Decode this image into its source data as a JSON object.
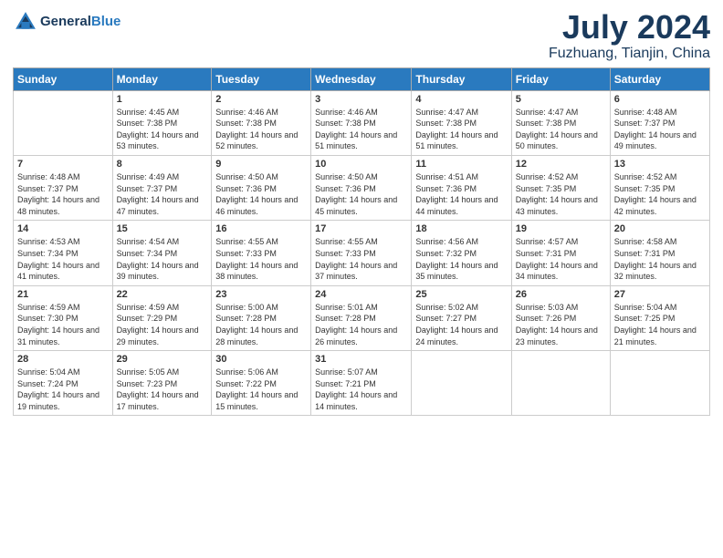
{
  "logo": {
    "text1": "General",
    "text2": "Blue"
  },
  "title": "July 2024",
  "location": "Fuzhuang, Tianjin, China",
  "weekdays": [
    "Sunday",
    "Monday",
    "Tuesday",
    "Wednesday",
    "Thursday",
    "Friday",
    "Saturday"
  ],
  "weeks": [
    [
      {
        "day": "",
        "sunrise": "",
        "sunset": "",
        "daylight": ""
      },
      {
        "day": "1",
        "sunrise": "Sunrise: 4:45 AM",
        "sunset": "Sunset: 7:38 PM",
        "daylight": "Daylight: 14 hours and 53 minutes."
      },
      {
        "day": "2",
        "sunrise": "Sunrise: 4:46 AM",
        "sunset": "Sunset: 7:38 PM",
        "daylight": "Daylight: 14 hours and 52 minutes."
      },
      {
        "day": "3",
        "sunrise": "Sunrise: 4:46 AM",
        "sunset": "Sunset: 7:38 PM",
        "daylight": "Daylight: 14 hours and 51 minutes."
      },
      {
        "day": "4",
        "sunrise": "Sunrise: 4:47 AM",
        "sunset": "Sunset: 7:38 PM",
        "daylight": "Daylight: 14 hours and 51 minutes."
      },
      {
        "day": "5",
        "sunrise": "Sunrise: 4:47 AM",
        "sunset": "Sunset: 7:38 PM",
        "daylight": "Daylight: 14 hours and 50 minutes."
      },
      {
        "day": "6",
        "sunrise": "Sunrise: 4:48 AM",
        "sunset": "Sunset: 7:37 PM",
        "daylight": "Daylight: 14 hours and 49 minutes."
      }
    ],
    [
      {
        "day": "7",
        "sunrise": "Sunrise: 4:48 AM",
        "sunset": "Sunset: 7:37 PM",
        "daylight": "Daylight: 14 hours and 48 minutes."
      },
      {
        "day": "8",
        "sunrise": "Sunrise: 4:49 AM",
        "sunset": "Sunset: 7:37 PM",
        "daylight": "Daylight: 14 hours and 47 minutes."
      },
      {
        "day": "9",
        "sunrise": "Sunrise: 4:50 AM",
        "sunset": "Sunset: 7:36 PM",
        "daylight": "Daylight: 14 hours and 46 minutes."
      },
      {
        "day": "10",
        "sunrise": "Sunrise: 4:50 AM",
        "sunset": "Sunset: 7:36 PM",
        "daylight": "Daylight: 14 hours and 45 minutes."
      },
      {
        "day": "11",
        "sunrise": "Sunrise: 4:51 AM",
        "sunset": "Sunset: 7:36 PM",
        "daylight": "Daylight: 14 hours and 44 minutes."
      },
      {
        "day": "12",
        "sunrise": "Sunrise: 4:52 AM",
        "sunset": "Sunset: 7:35 PM",
        "daylight": "Daylight: 14 hours and 43 minutes."
      },
      {
        "day": "13",
        "sunrise": "Sunrise: 4:52 AM",
        "sunset": "Sunset: 7:35 PM",
        "daylight": "Daylight: 14 hours and 42 minutes."
      }
    ],
    [
      {
        "day": "14",
        "sunrise": "Sunrise: 4:53 AM",
        "sunset": "Sunset: 7:34 PM",
        "daylight": "Daylight: 14 hours and 41 minutes."
      },
      {
        "day": "15",
        "sunrise": "Sunrise: 4:54 AM",
        "sunset": "Sunset: 7:34 PM",
        "daylight": "Daylight: 14 hours and 39 minutes."
      },
      {
        "day": "16",
        "sunrise": "Sunrise: 4:55 AM",
        "sunset": "Sunset: 7:33 PM",
        "daylight": "Daylight: 14 hours and 38 minutes."
      },
      {
        "day": "17",
        "sunrise": "Sunrise: 4:55 AM",
        "sunset": "Sunset: 7:33 PM",
        "daylight": "Daylight: 14 hours and 37 minutes."
      },
      {
        "day": "18",
        "sunrise": "Sunrise: 4:56 AM",
        "sunset": "Sunset: 7:32 PM",
        "daylight": "Daylight: 14 hours and 35 minutes."
      },
      {
        "day": "19",
        "sunrise": "Sunrise: 4:57 AM",
        "sunset": "Sunset: 7:31 PM",
        "daylight": "Daylight: 14 hours and 34 minutes."
      },
      {
        "day": "20",
        "sunrise": "Sunrise: 4:58 AM",
        "sunset": "Sunset: 7:31 PM",
        "daylight": "Daylight: 14 hours and 32 minutes."
      }
    ],
    [
      {
        "day": "21",
        "sunrise": "Sunrise: 4:59 AM",
        "sunset": "Sunset: 7:30 PM",
        "daylight": "Daylight: 14 hours and 31 minutes."
      },
      {
        "day": "22",
        "sunrise": "Sunrise: 4:59 AM",
        "sunset": "Sunset: 7:29 PM",
        "daylight": "Daylight: 14 hours and 29 minutes."
      },
      {
        "day": "23",
        "sunrise": "Sunrise: 5:00 AM",
        "sunset": "Sunset: 7:28 PM",
        "daylight": "Daylight: 14 hours and 28 minutes."
      },
      {
        "day": "24",
        "sunrise": "Sunrise: 5:01 AM",
        "sunset": "Sunset: 7:28 PM",
        "daylight": "Daylight: 14 hours and 26 minutes."
      },
      {
        "day": "25",
        "sunrise": "Sunrise: 5:02 AM",
        "sunset": "Sunset: 7:27 PM",
        "daylight": "Daylight: 14 hours and 24 minutes."
      },
      {
        "day": "26",
        "sunrise": "Sunrise: 5:03 AM",
        "sunset": "Sunset: 7:26 PM",
        "daylight": "Daylight: 14 hours and 23 minutes."
      },
      {
        "day": "27",
        "sunrise": "Sunrise: 5:04 AM",
        "sunset": "Sunset: 7:25 PM",
        "daylight": "Daylight: 14 hours and 21 minutes."
      }
    ],
    [
      {
        "day": "28",
        "sunrise": "Sunrise: 5:04 AM",
        "sunset": "Sunset: 7:24 PM",
        "daylight": "Daylight: 14 hours and 19 minutes."
      },
      {
        "day": "29",
        "sunrise": "Sunrise: 5:05 AM",
        "sunset": "Sunset: 7:23 PM",
        "daylight": "Daylight: 14 hours and 17 minutes."
      },
      {
        "day": "30",
        "sunrise": "Sunrise: 5:06 AM",
        "sunset": "Sunset: 7:22 PM",
        "daylight": "Daylight: 14 hours and 15 minutes."
      },
      {
        "day": "31",
        "sunrise": "Sunrise: 5:07 AM",
        "sunset": "Sunset: 7:21 PM",
        "daylight": "Daylight: 14 hours and 14 minutes."
      },
      {
        "day": "",
        "sunrise": "",
        "sunset": "",
        "daylight": ""
      },
      {
        "day": "",
        "sunrise": "",
        "sunset": "",
        "daylight": ""
      },
      {
        "day": "",
        "sunrise": "",
        "sunset": "",
        "daylight": ""
      }
    ]
  ]
}
